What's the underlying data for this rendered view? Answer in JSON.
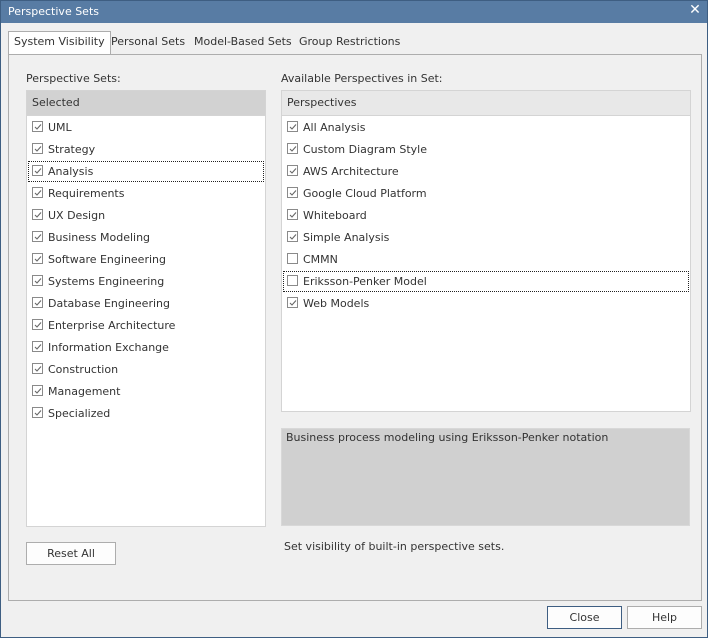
{
  "window": {
    "title": "Perspective Sets",
    "close_glyph": "✕"
  },
  "tabs": [
    {
      "label": "System Visibility",
      "active": true
    },
    {
      "label": "Personal Sets",
      "active": false
    },
    {
      "label": "Model-Based Sets",
      "active": false
    },
    {
      "label": "Group Restrictions",
      "active": false
    }
  ],
  "left": {
    "label": "Perspective Sets:",
    "header": "Selected",
    "items": [
      {
        "label": "UML",
        "checked": true
      },
      {
        "label": "Strategy",
        "checked": true
      },
      {
        "label": "Analysis",
        "checked": true,
        "focused": true
      },
      {
        "label": "Requirements",
        "checked": true
      },
      {
        "label": "UX Design",
        "checked": true
      },
      {
        "label": "Business Modeling",
        "checked": true
      },
      {
        "label": "Software Engineering",
        "checked": true
      },
      {
        "label": "Systems Engineering",
        "checked": true
      },
      {
        "label": "Database Engineering",
        "checked": true
      },
      {
        "label": "Enterprise Architecture",
        "checked": true
      },
      {
        "label": "Information Exchange",
        "checked": true
      },
      {
        "label": "Construction",
        "checked": true
      },
      {
        "label": "Management",
        "checked": true
      },
      {
        "label": "Specialized",
        "checked": true
      }
    ],
    "reset_label": "Reset All"
  },
  "right": {
    "label": "Available Perspectives in Set:",
    "header": "Perspectives",
    "items": [
      {
        "label": "All Analysis",
        "checked": true
      },
      {
        "label": "Custom Diagram Style",
        "checked": true
      },
      {
        "label": "AWS Architecture",
        "checked": true
      },
      {
        "label": "Google Cloud Platform",
        "checked": true
      },
      {
        "label": "Whiteboard",
        "checked": true
      },
      {
        "label": "Simple Analysis",
        "checked": true
      },
      {
        "label": "CMMN",
        "checked": false
      },
      {
        "label": "Eriksson-Penker Model",
        "checked": false,
        "focused": true
      },
      {
        "label": "Web Models",
        "checked": true
      }
    ],
    "description": "Business process modeling using Eriksson-Penker notation",
    "hint": "Set visibility of built-in perspective sets."
  },
  "footer": {
    "close_label": "Close",
    "help_label": "Help"
  }
}
